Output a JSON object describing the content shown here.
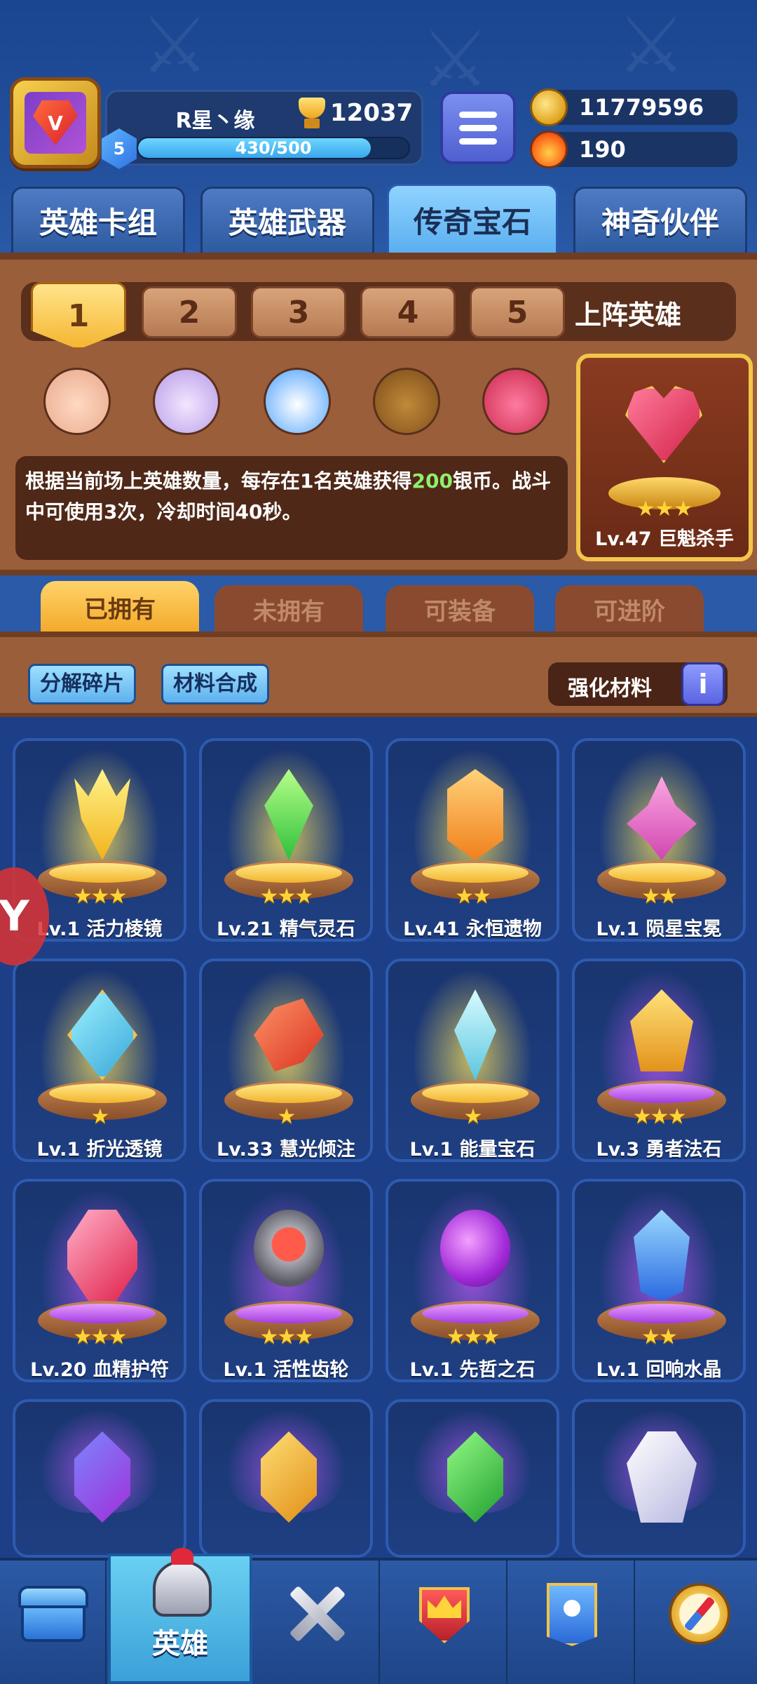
{
  "player": {
    "name": "R星丶缘",
    "trophies": "12037",
    "level": "5",
    "xp_text": "430/500",
    "xp_progress": 0.86
  },
  "currencies": {
    "coins": "11779596",
    "fire": "190"
  },
  "main_tabs": [
    {
      "label": "英雄卡组"
    },
    {
      "label": "英雄武器"
    },
    {
      "label": "传奇宝石"
    },
    {
      "label": "神奇伙伴"
    }
  ],
  "lineup": {
    "slots": [
      "1",
      "2",
      "3",
      "4",
      "5"
    ],
    "label": "上阵英雄",
    "description_prefix": "根据当前场上英雄数量，每存在1名英雄获得",
    "description_highlight": "200",
    "description_suffix": "银币。战斗中可使用3次，冷却时间40秒。",
    "highlight_color": "#8ff06a",
    "equipped": {
      "name": "Lv.47 巨魁杀手",
      "stars": "★★★"
    }
  },
  "filter_tabs": [
    {
      "label": "已拥有"
    },
    {
      "label": "未拥有"
    },
    {
      "label": "可装备"
    },
    {
      "label": "可进阶"
    }
  ],
  "tools": {
    "decompose": "分解碎片",
    "synthesize": "材料合成",
    "enhance": "强化材料",
    "info_icon": "i"
  },
  "gems": [
    {
      "name": "Lv.1 活力棱镜",
      "stars": "★★★"
    },
    {
      "name": "Lv.21 精气灵石",
      "stars": "★★★"
    },
    {
      "name": "Lv.41 永恒遗物",
      "stars": "★★"
    },
    {
      "name": "Lv.1 陨星宝冕",
      "stars": "★★"
    },
    {
      "name": "Lv.1 折光透镜",
      "stars": "★"
    },
    {
      "name": "Lv.33 慧光倾注",
      "stars": "★"
    },
    {
      "name": "Lv.1 能量宝石",
      "stars": "★"
    },
    {
      "name": "Lv.3 勇者法石",
      "stars": "★★★"
    },
    {
      "name": "Lv.20 血精护符",
      "stars": "★★★"
    },
    {
      "name": "Lv.1 活性齿轮",
      "stars": "★★★"
    },
    {
      "name": "Lv.1 先哲之石",
      "stars": "★★★"
    },
    {
      "name": "Lv.1 回响水晶",
      "stars": "★★"
    }
  ],
  "bottom_nav": {
    "hero_label": "英雄"
  }
}
